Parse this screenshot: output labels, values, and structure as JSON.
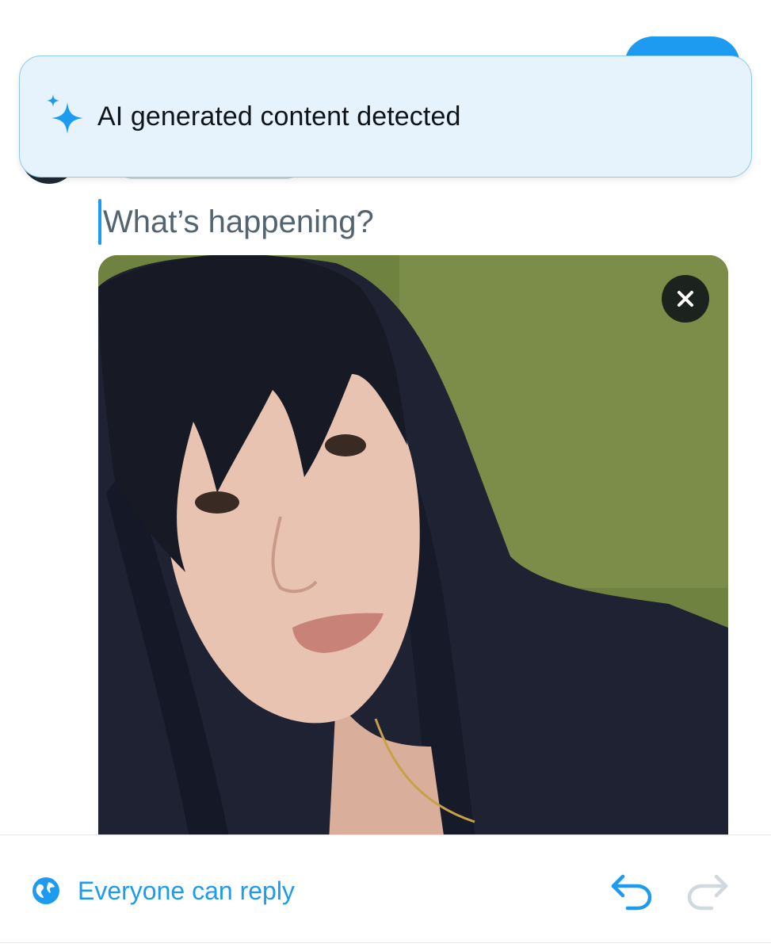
{
  "toast": {
    "text": "AI generated content detected",
    "icon": "sparkle-icon",
    "background": "#e6f3fd",
    "accent": "#1d9bf0"
  },
  "composer": {
    "placeholder": "What’s happening?"
  },
  "media": {
    "remove_icon": "close-icon"
  },
  "footer": {
    "reply_setting_label": "Everyone can reply",
    "reply_icon": "globe-icon",
    "undo_icon": "undo-icon",
    "redo_icon": "redo-icon"
  },
  "colors": {
    "accent": "#1d9bf0",
    "text_primary": "#0f1419",
    "text_secondary": "#536471",
    "disabled": "#cfd9de"
  }
}
